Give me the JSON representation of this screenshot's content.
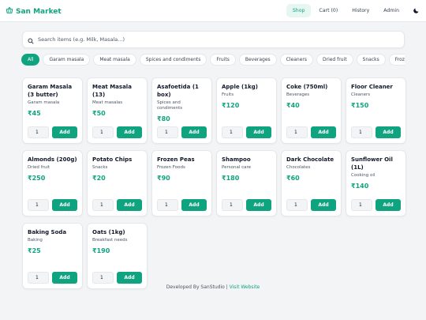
{
  "brand": {
    "name": "San Market"
  },
  "nav": {
    "links": [
      {
        "label": "Shop"
      },
      {
        "label": "Cart (0)"
      },
      {
        "label": "History"
      },
      {
        "label": "Admin"
      }
    ]
  },
  "search": {
    "placeholder": "Search items (e.g. Milk, Masala...)",
    "value": ""
  },
  "categories": [
    "All",
    "Garam masala",
    "Meat masala",
    "Spices and condiments",
    "Fruits",
    "Beverages",
    "Cleaners",
    "Dried fruit",
    "Snacks",
    "Frozen Fo"
  ],
  "products": [
    {
      "name": "Garam Masala (3 butter)",
      "category": "Garam masala",
      "price": "₹45",
      "qty": "1",
      "add_label": "Add"
    },
    {
      "name": "Meat Masala (13)",
      "category": "Meat masalas",
      "price": "₹50",
      "qty": "1",
      "add_label": "Add"
    },
    {
      "name": "Asafoetida (1 box)",
      "category": "Spices and condiments",
      "price": "₹80",
      "qty": "1",
      "add_label": "Add"
    },
    {
      "name": "Apple (1kg)",
      "category": "Fruits",
      "price": "₹120",
      "qty": "1",
      "add_label": "Add"
    },
    {
      "name": "Coke (750ml)",
      "category": "Beverages",
      "price": "₹40",
      "qty": "1",
      "add_label": "Add"
    },
    {
      "name": "Floor Cleaner",
      "category": "Cleaners",
      "price": "₹150",
      "qty": "1",
      "add_label": "Add"
    },
    {
      "name": "Almonds (200g)",
      "category": "Dried fruit",
      "price": "₹250",
      "qty": "1",
      "add_label": "Add"
    },
    {
      "name": "Potato Chips",
      "category": "Snacks",
      "price": "₹20",
      "qty": "1",
      "add_label": "Add"
    },
    {
      "name": "Frozen Peas",
      "category": "Frozen Foods",
      "price": "₹90",
      "qty": "1",
      "add_label": "Add"
    },
    {
      "name": "Shampoo",
      "category": "Personal care",
      "price": "₹180",
      "qty": "1",
      "add_label": "Add"
    },
    {
      "name": "Dark Chocolate",
      "category": "Chocolates",
      "price": "₹60",
      "qty": "1",
      "add_label": "Add"
    },
    {
      "name": "Sunflower Oil (1L)",
      "category": "Cooking oil",
      "price": "₹140",
      "qty": "1",
      "add_label": "Add"
    },
    {
      "name": "Baking Soda",
      "category": "Baking",
      "price": "₹25",
      "qty": "1",
      "add_label": "Add"
    },
    {
      "name": "Oats (1kg)",
      "category": "Breakfast needs",
      "price": "₹190",
      "qty": "1",
      "add_label": "Add"
    }
  ],
  "footer": {
    "text": "Developed By SanStudio | ",
    "link": "Visit Website"
  },
  "colors": {
    "accent": "#10a37f",
    "background": "#f3f4f6",
    "card": "#ffffff"
  },
  "icons": {
    "brand": "basket-icon",
    "search": "search-icon",
    "theme": "moon-icon"
  }
}
